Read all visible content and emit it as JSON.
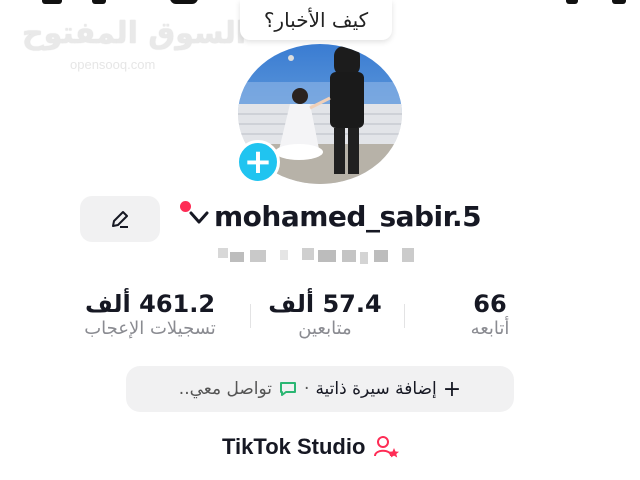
{
  "watermark": {
    "arabic": "السوق المفتوح",
    "latin": "opensooq.com"
  },
  "bubble": {
    "text": "كيف الأخبار؟"
  },
  "profile": {
    "username": "mohamed_sabir.5"
  },
  "stats": [
    {
      "value": "66",
      "label": "أتابعه"
    },
    {
      "value": "57.4 ألف",
      "label": "متابعين"
    },
    {
      "value": "461.2 ألف",
      "label": "تسجيلات الإعجاب"
    }
  ],
  "bio": {
    "add_label": "إضافة سيرة ذاتية",
    "separator": "·",
    "contact_label": "تواصل معي.."
  },
  "studio": {
    "label": "TikTok Studio"
  },
  "colors": {
    "accent_blue": "#20c4f0",
    "red": "#fe2c55",
    "green_icon": "#2bb673",
    "pink_icon": "#fe2c55"
  }
}
